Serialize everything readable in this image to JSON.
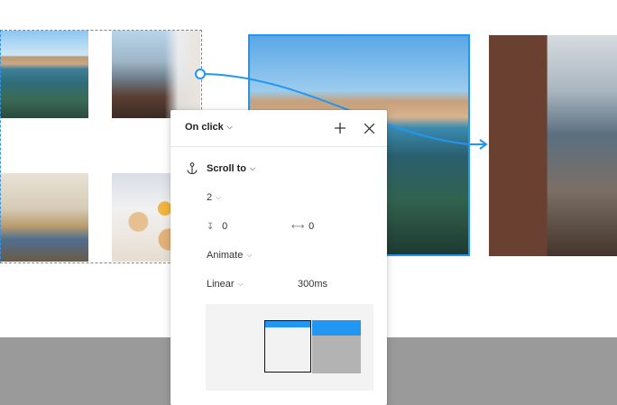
{
  "popover": {
    "trigger_label": "On click",
    "add_icon": "plus-icon",
    "close_icon": "close-icon",
    "action": {
      "icon": "anchor-icon",
      "label": "Scroll to"
    },
    "destination": "2",
    "offset_x": {
      "icon": "offset-x-icon",
      "value": "0"
    },
    "offset_y": {
      "icon": "offset-y-icon",
      "value": "0"
    },
    "animation": "Animate",
    "easing": "Linear",
    "duration": "300ms"
  },
  "colors": {
    "accent": "#2196f3",
    "bottom_bar": "#9a9a9a"
  }
}
